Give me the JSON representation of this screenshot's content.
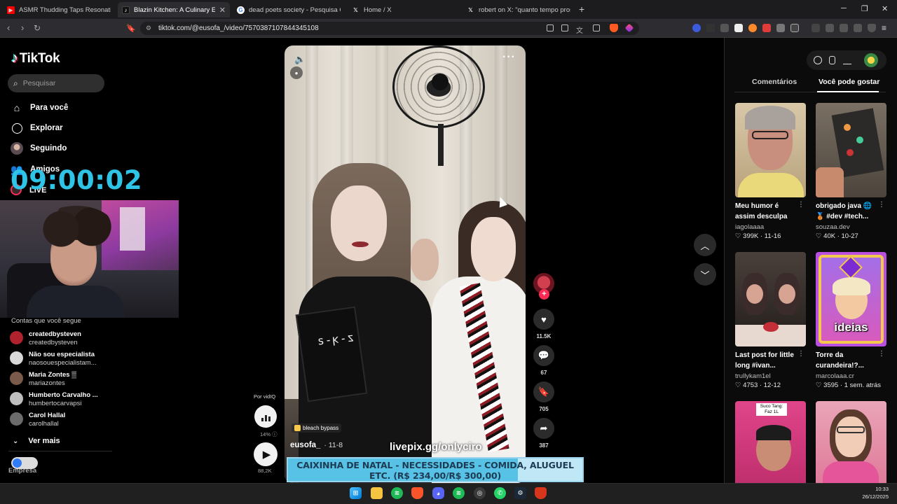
{
  "browser": {
    "tabs": [
      {
        "title": "ASMR Thudding Taps Resonating in V",
        "icon": "youtube-icon",
        "color": "#ff0000"
      },
      {
        "title": "Blazin Kitchen: A Culinary Experie",
        "icon": "tiktok-icon",
        "color": "#111111",
        "active": true
      },
      {
        "title": "dead poets society - Pesquisa Googl",
        "icon": "google-icon",
        "color": "#ffffff"
      },
      {
        "title": "Home / X",
        "icon": "x-icon",
        "color": "#000000"
      },
      {
        "title": "robert on X: \"quanto tempo pros bol",
        "icon": "x-icon",
        "color": "#000000"
      }
    ],
    "url": "tiktok.com/@eusofa_/video/7570387107844345108"
  },
  "sidebar": {
    "brand": "TikTok",
    "search_placeholder": "Pesquisar",
    "menu": [
      {
        "label": "Para você",
        "icon": "home-icon"
      },
      {
        "label": "Explorar",
        "icon": "compass-icon"
      },
      {
        "label": "Seguindo",
        "icon": "following-avatar-icon"
      },
      {
        "label": "Amigos",
        "icon": "friends-icon"
      }
    ],
    "live_label": "LIVE",
    "following_title": "Contas que você segue",
    "accounts": [
      {
        "name": "createdbysteven",
        "handle": "createdbysteven",
        "color": "#b0222e"
      },
      {
        "name": "Não sou especialista",
        "handle": "naosouespecialistam...",
        "color": "#d8d8d8"
      },
      {
        "name": "Maria Zontes ▒",
        "handle": "mariazontes",
        "color": "#7a5a4a"
      },
      {
        "name": "Humberto Carvalho ...",
        "handle": "humbertocarvapsi",
        "color": "#bfbfbf"
      },
      {
        "name": "Carol Hallal",
        "handle": "carolhallal",
        "color": "#6b6b6b"
      }
    ],
    "see_more": "Ver mais",
    "footer": "Empresa"
  },
  "overlay": {
    "timer": "09:00:02",
    "livepix": "livepix.gg/onlyciro",
    "donation_text": "CAIXINHA DE NATAL - NECESSIDADES - COMIDA, ALUGUEL ETC. (R$ 234,00/R$ 300,00)",
    "donation_progress": 0.78
  },
  "video": {
    "author": "eusofa_",
    "date": " · 11-8",
    "sticker": "bleach bypass",
    "book_text": "z-ʞ-ƨ"
  },
  "vidiq": {
    "label": "Por vidIQ",
    "percent": "14%",
    "play_count": "88,2K"
  },
  "actions": {
    "likes": "11.5K",
    "comments": "67",
    "saves": "705",
    "shares": "387"
  },
  "right_panel": {
    "tabs": [
      "Comentários",
      "Você pode gostar"
    ],
    "cards": [
      {
        "caption": "Meu humor é assim desculpa",
        "user": "iagolaaaa",
        "likes": "399K",
        "date": "11-16",
        "bg": "#c9b89a"
      },
      {
        "caption": "obrigado java 🌐 🥉 #dev #tech...",
        "user": "souzaa.dev",
        "likes": "40K",
        "date": "10-27",
        "bg": "#6e6458"
      },
      {
        "caption": "Last post for little long #ivan...",
        "user": "trullykam1el",
        "likes": "4753",
        "date": "12-12",
        "bg": "#3a2f2c"
      },
      {
        "caption": "Torre da curandeira!?...",
        "user": "marcolaaa.cr",
        "likes": "3595",
        "date": "1 sem. atrás",
        "bg": "#9d2fd0",
        "thumb_text": "ideias"
      },
      {
        "caption": "",
        "user": "",
        "likes": "",
        "date": "",
        "bg": "#e0458a",
        "thumb_text": "Suco Tang: Faz 1L"
      },
      {
        "caption": "",
        "user": "",
        "likes": "",
        "date": "",
        "bg": "#e58aa6"
      }
    ]
  },
  "system": {
    "time": "10:33",
    "date": "26/12/2025"
  }
}
